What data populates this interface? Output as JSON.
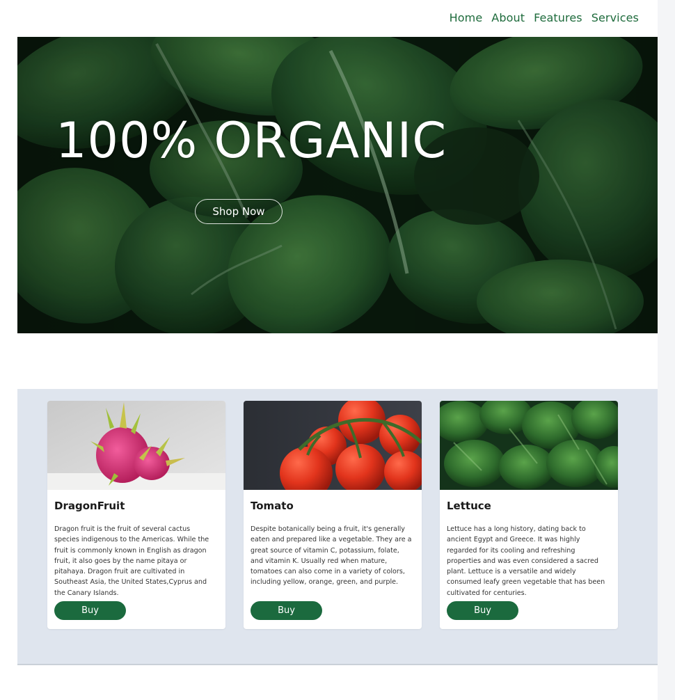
{
  "nav": {
    "links": [
      "Home",
      "About",
      "Features",
      "Services"
    ],
    "color": "#1e6b3c"
  },
  "hero": {
    "title": "100% ORGANIC",
    "button_label": "Shop Now",
    "image": "leafy-greens-photo"
  },
  "products": [
    {
      "name": "DragonFruit",
      "image": "dragon-fruit-photo",
      "description": "Dragon fruit is the fruit of several cactus species indigenous to the Americas. While the fruit is commonly known in English as dragon fruit, it also goes by the name pitaya or pitahaya. Dragon fruit are cultivated in Southeast Asia, the United States,Cyprus and the Canary Islands.",
      "button_label": "Buy"
    },
    {
      "name": "Tomato",
      "image": "tomato-photo",
      "description": "Despite botanically being a fruit, it's generally eaten and prepared like a vegetable. They are a great source of vitamin C, potassium, folate, and vitamin K. Usually red when mature, tomatoes can also come in a variety of colors, including yellow, orange, green, and purple.",
      "button_label": "Buy"
    },
    {
      "name": "Lettuce",
      "image": "lettuce-photo",
      "description": "Lettuce has a long history, dating back to ancient Egypt and Greece. It was highly regarded for its cooling and refreshing properties and was even considered a sacred plant. Lettuce is a versatile and widely consumed leafy green vegetable that has been cultivated for centuries.",
      "button_label": "Buy"
    }
  ],
  "colors": {
    "accent": "#1b6a3e",
    "section_bg": "#dfe5ee",
    "hero_dark": "#0d200f"
  }
}
